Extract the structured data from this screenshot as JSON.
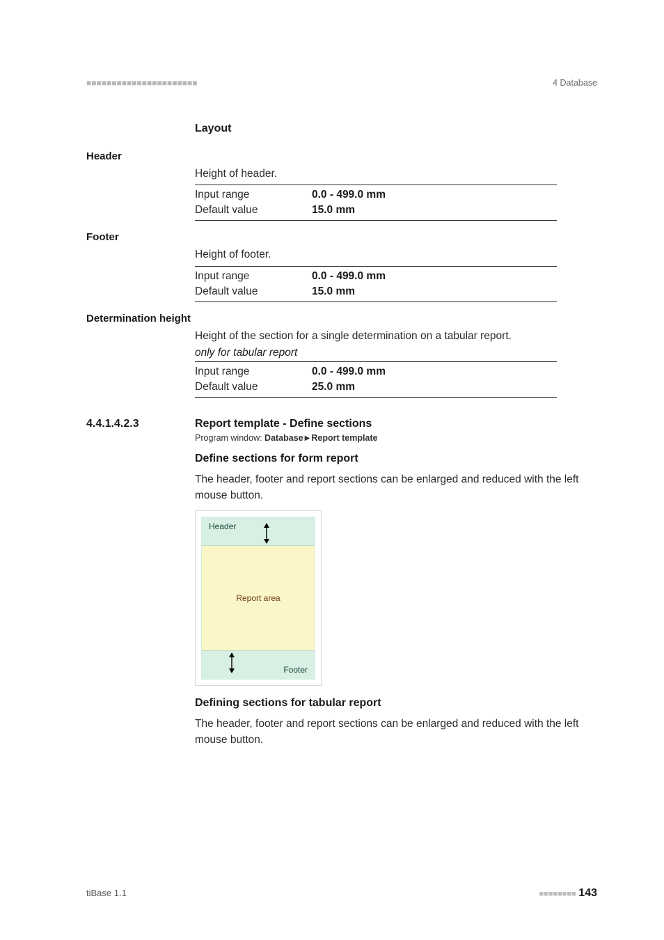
{
  "topbar": {
    "dashes": "■■■■■■■■■■■■■■■■■■■■■■",
    "right": "4 Database"
  },
  "layout": {
    "heading": "Layout",
    "header": {
      "side": "Header",
      "desc": "Height of header.",
      "input_range_label": "Input range",
      "input_range_value": "0.0 - 499.0 mm",
      "default_label": "Default value",
      "default_value": "15.0 mm"
    },
    "footer_s": {
      "side": "Footer",
      "desc": "Height of footer.",
      "input_range_label": "Input range",
      "input_range_value": "0.0 - 499.0 mm",
      "default_label": "Default value",
      "default_value": "15.0 mm"
    },
    "det": {
      "side": "Determination height",
      "desc": "Height of the section for a single determination on a tabular report.",
      "note": "only for tabular report",
      "input_range_label": "Input range",
      "input_range_value": "0.0 - 499.0 mm",
      "default_label": "Default value",
      "default_value": "25.0 mm"
    }
  },
  "section": {
    "number": "4.4.1.4.2.3",
    "title": "Report template - Define sections",
    "progwin_prefix": "Program window: ",
    "progwin_db": "Database",
    "progwin_rt": "Report template",
    "sub1": "Define sections for form report",
    "sub1_body": "The header, footer and report sections can be enlarged and reduced with the left mouse button.",
    "diagram": {
      "header": "Header",
      "body": "Report area",
      "footer": "Footer"
    },
    "sub2": "Defining sections for tabular report",
    "sub2_body": "The header, footer and report sections can be enlarged and reduced with the left mouse button."
  },
  "pagefooter": {
    "left": "tiBase 1.1",
    "dashes": "■■■■■■■■",
    "page": "143"
  }
}
